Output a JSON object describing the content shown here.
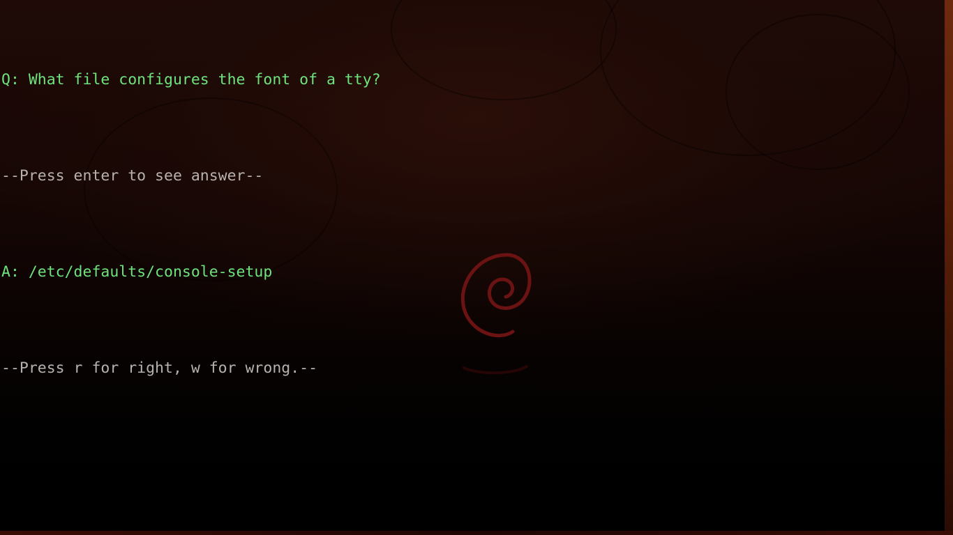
{
  "terminal": {
    "lines": [
      {
        "text": "Q: What file configures the font of a tty?",
        "color": "#6fe37b"
      },
      {
        "text": "--Press enter to see answer--",
        "color": "#b8b2ae"
      },
      {
        "text": "A: /etc/defaults/console-setup",
        "color": "#6fe37b"
      },
      {
        "text": "--Press r for right, w for wrong.--",
        "color": "#b8b2ae"
      }
    ]
  },
  "background": {
    "logo": "debian-swirl-icon",
    "accent_color": "#7a1414"
  }
}
